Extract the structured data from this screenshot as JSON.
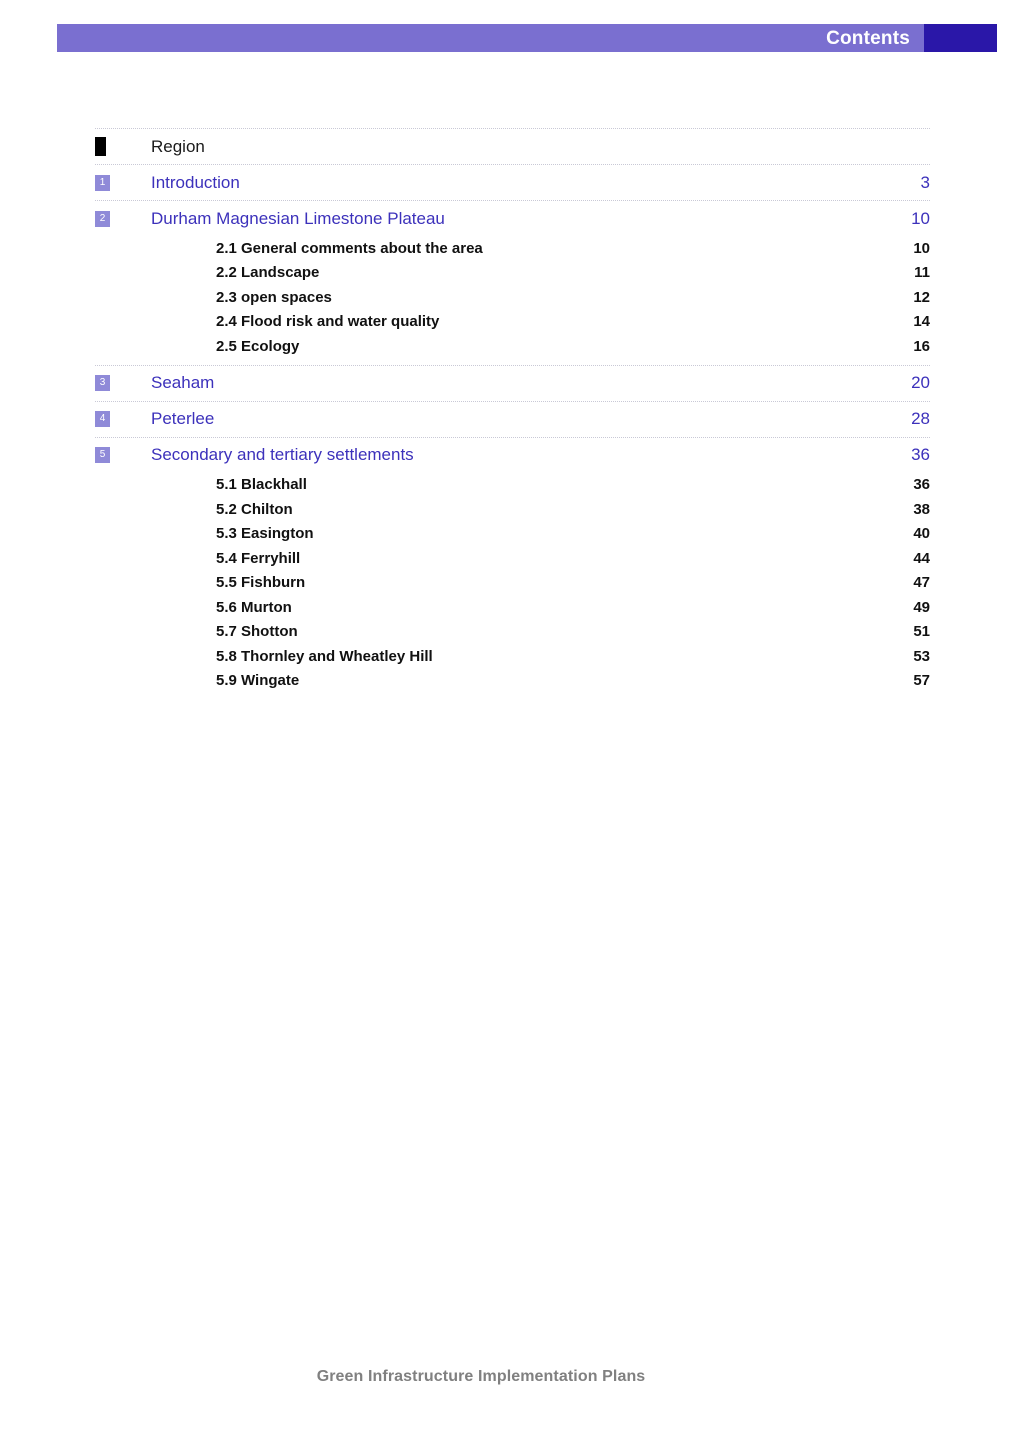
{
  "header": {
    "title": "Contents",
    "band_color": "#7a6fd0",
    "end_block_color": "#2a17a8",
    "title_color": "#ffffff"
  },
  "theme": {
    "heading_color": "#3c31bb",
    "marker_color": "#8f8ad8",
    "sub_color": "#111111",
    "rule_color": "#c9c9d6",
    "footer_color": "#808080"
  },
  "toc": {
    "entries": [
      {
        "marker": "",
        "marker_style": "solid-square",
        "title": "Region",
        "page": "",
        "title_style": "plain",
        "children": []
      },
      {
        "marker": "1",
        "marker_style": "numbered",
        "title": "Introduction",
        "page": "3",
        "title_style": "link",
        "children": []
      },
      {
        "marker": "2",
        "marker_style": "numbered",
        "title": "Durham Magnesian Limestone Plateau",
        "page": "10",
        "title_style": "link",
        "children": [
          {
            "title": "2.1 General comments about the area",
            "page": "10"
          },
          {
            "title": "2.2 Landscape",
            "page": "11"
          },
          {
            "title": "2.3 open spaces",
            "page": "12"
          },
          {
            "title": "2.4 Flood risk and water quality",
            "page": "14"
          },
          {
            "title": "2.5 Ecology",
            "page": "16"
          }
        ]
      },
      {
        "marker": "3",
        "marker_style": "numbered",
        "title": "Seaham",
        "page": "20",
        "title_style": "link",
        "children": []
      },
      {
        "marker": "4",
        "marker_style": "numbered",
        "title": "Peterlee",
        "page": "28",
        "title_style": "link",
        "children": []
      },
      {
        "marker": "5",
        "marker_style": "numbered",
        "title": "Secondary and tertiary settlements",
        "page": "36",
        "title_style": "link",
        "children": [
          {
            "title": "5.1 Blackhall",
            "page": "36"
          },
          {
            "title": "5.2 Chilton",
            "page": "38"
          },
          {
            "title": "5.3 Easington",
            "page": "40"
          },
          {
            "title": "5.4 Ferryhill",
            "page": "44"
          },
          {
            "title": "5.5 Fishburn",
            "page": "47"
          },
          {
            "title": "5.6 Murton",
            "page": "49"
          },
          {
            "title": "5.7 Shotton",
            "page": "51"
          },
          {
            "title": "5.8 Thornley and Wheatley Hill",
            "page": "53"
          },
          {
            "title": "5.9 Wingate",
            "page": "57"
          }
        ]
      }
    ]
  },
  "footer": {
    "text": "Green Infrastructure Implementation Plans"
  }
}
